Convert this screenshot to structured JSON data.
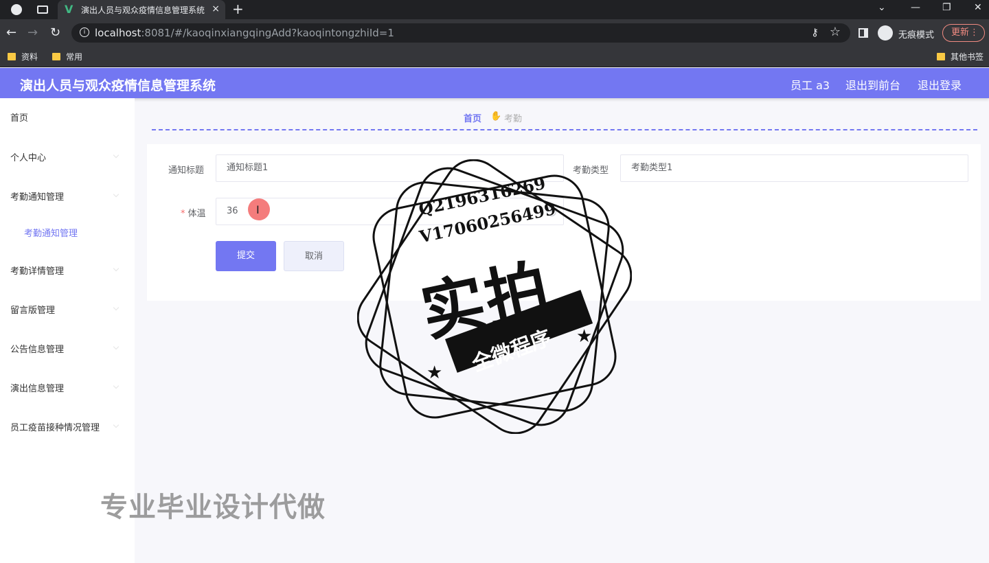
{
  "browser": {
    "tab_title": "演出人员与观众疫情信息管理系统",
    "tab_close": "×",
    "new_tab": "+",
    "url_host": "localhost",
    "url_path": ":8081/#/kaoqinxiangqingAdd?kaoqintongzhiId=1",
    "incognito_label": "无痕模式",
    "update_label": "更新",
    "bookmarks": [
      "资料",
      "常用"
    ],
    "other_bookmarks": "其他书签"
  },
  "header": {
    "title": "演出人员与观众疫情信息管理系统",
    "user": "员工 a3",
    "back_to_front": "退出到前台",
    "logout": "退出登录",
    "accent_color": "#7377f2"
  },
  "sidebar": {
    "items": [
      {
        "label": "首页"
      },
      {
        "label": "个人中心"
      },
      {
        "label": "考勤通知管理"
      },
      {
        "label": "考勤通知管理"
      },
      {
        "label": "考勤详情管理"
      },
      {
        "label": "留言版管理"
      },
      {
        "label": "公告信息管理"
      },
      {
        "label": "演出信息管理"
      },
      {
        "label": "员工疫苗接种情况管理"
      }
    ]
  },
  "breadcrumb": {
    "home": "首页",
    "current": "考勤"
  },
  "form": {
    "title_label": "通知标题",
    "title_value": "通知标题1",
    "type_label": "考勤类型",
    "type_value": "考勤类型1",
    "temp_label": "体温",
    "temp_required": "*",
    "temp_value": "36",
    "submit": "提交",
    "cancel": "取消"
  },
  "watermark": {
    "qq": "Q2196316269",
    "wechat": "V17060256499",
    "big": "实拍",
    "banner": "全微程序",
    "footer": "专业毕业设计代做"
  }
}
